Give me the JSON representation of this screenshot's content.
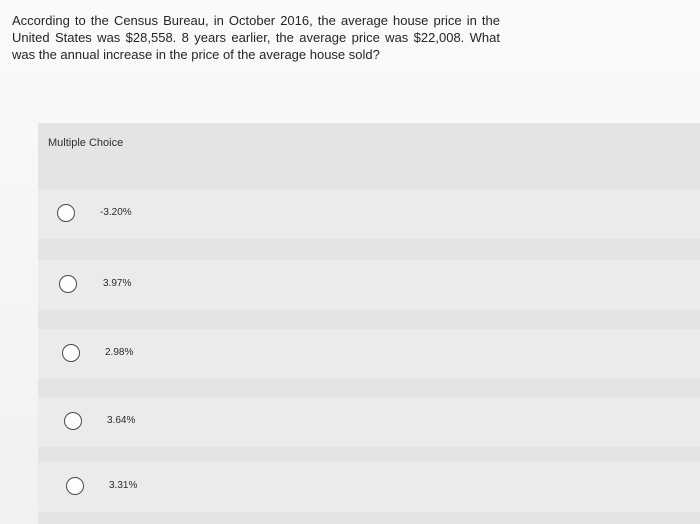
{
  "question": {
    "text": "According to the Census Bureau, in October 2016, the average house price in the United States was $28,558. 8 years earlier, the average price was $22,008. What was the annual increase in the price of the average house sold?"
  },
  "multiple_choice": {
    "heading": "Multiple Choice",
    "options": [
      {
        "label": "-3.20%"
      },
      {
        "label": "3.97%"
      },
      {
        "label": "2.98%"
      },
      {
        "label": "3.64%"
      },
      {
        "label": "3.31%"
      }
    ]
  }
}
